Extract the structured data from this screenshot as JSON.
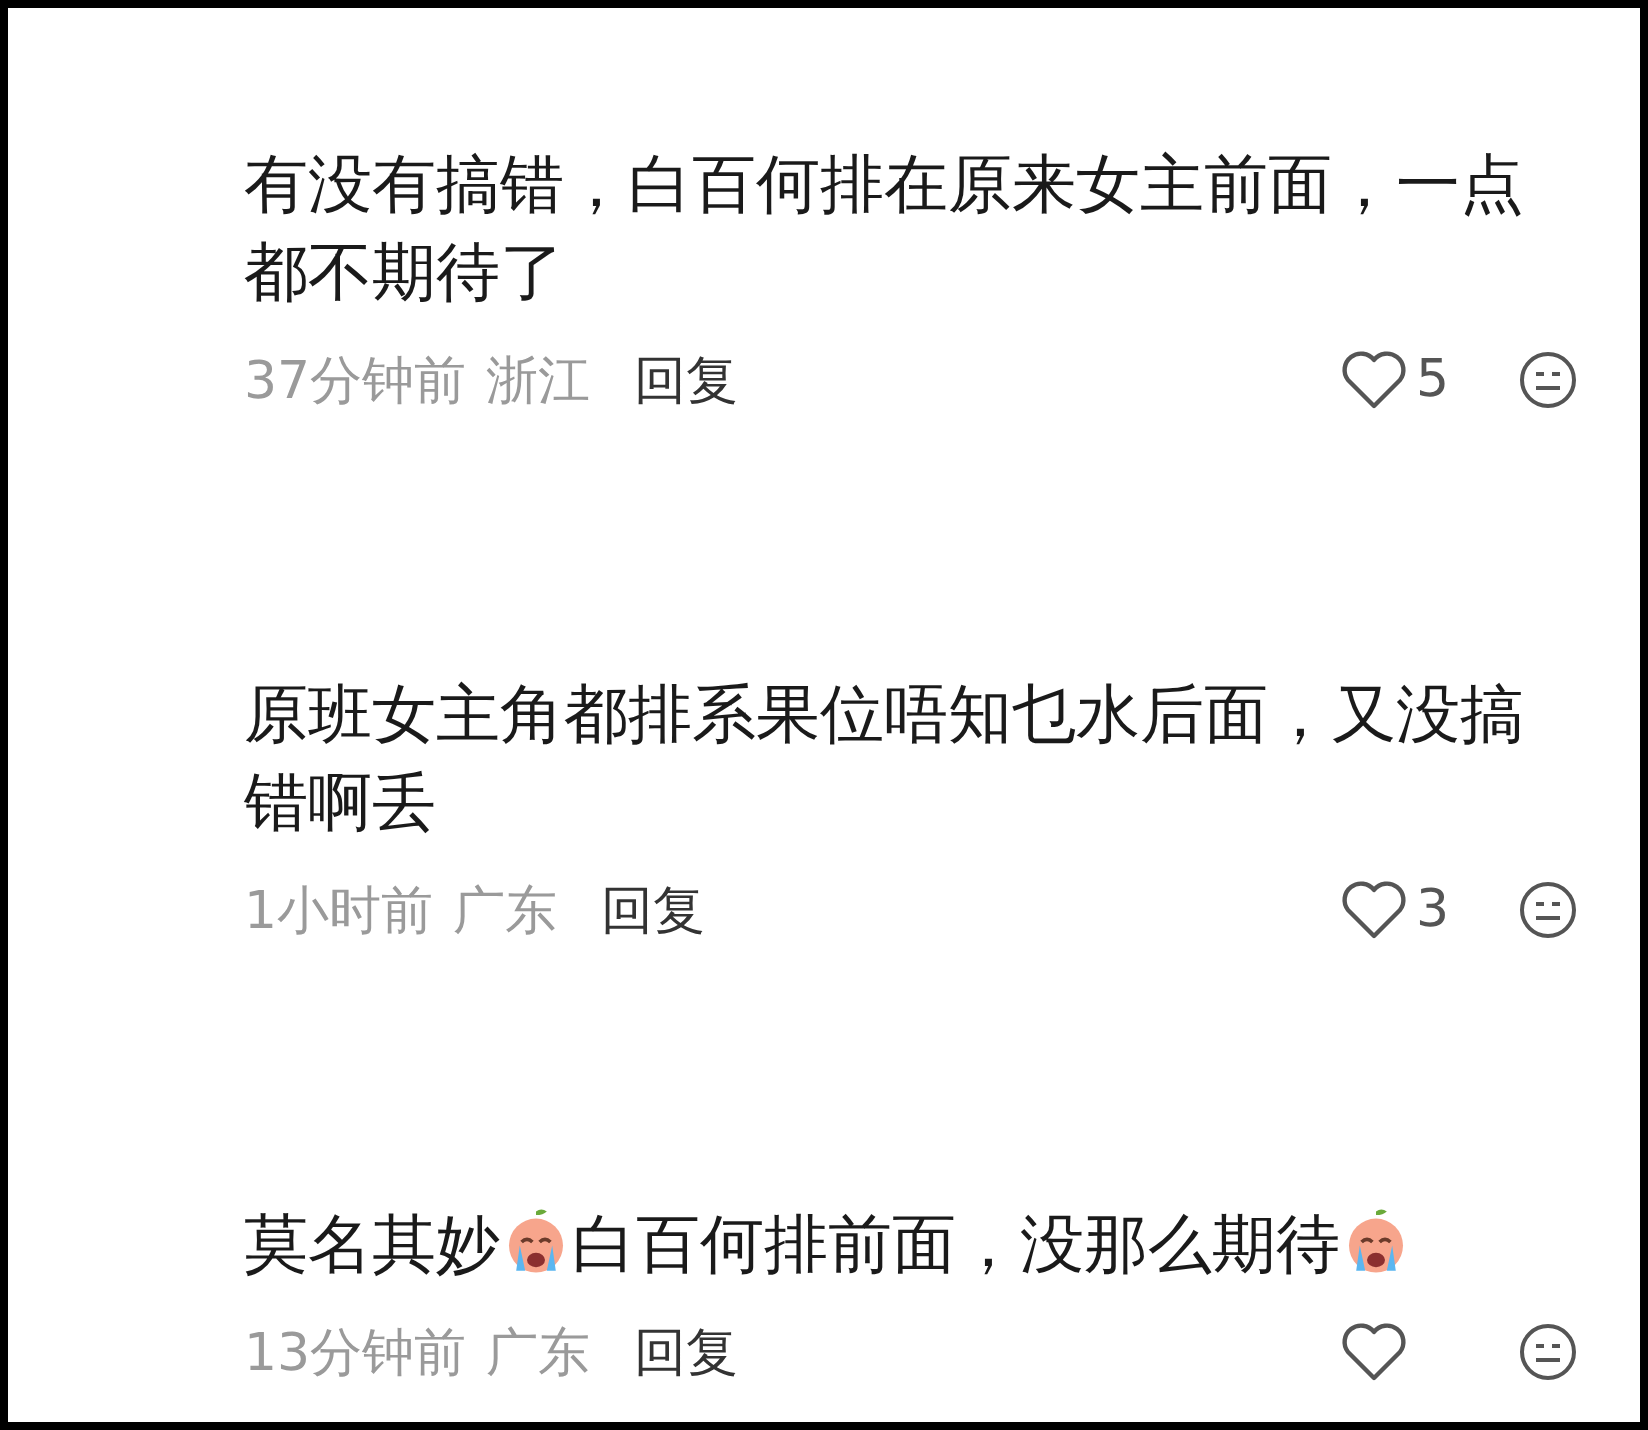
{
  "comments": [
    {
      "segments": [
        {
          "kind": "text",
          "text": "有没有搞错，白百何排在原来女主前面，一点都不期待了"
        }
      ],
      "time": "37分钟前",
      "location": "浙江",
      "reply": "回复",
      "likes": "5"
    },
    {
      "segments": [
        {
          "kind": "text",
          "text": "原班女主角都排系果位唔知乜水后面，又没搞错啊丢"
        }
      ],
      "time": "1小时前",
      "location": "广东",
      "reply": "回复",
      "likes": "3"
    },
    {
      "segments": [
        {
          "kind": "text",
          "text": "莫名其妙"
        },
        {
          "kind": "emoji"
        },
        {
          "kind": "text",
          "text": "白百何排前面，没那么期待"
        },
        {
          "kind": "emoji"
        }
      ],
      "time": "13分钟前",
      "location": "广东",
      "reply": "回复"
    }
  ]
}
